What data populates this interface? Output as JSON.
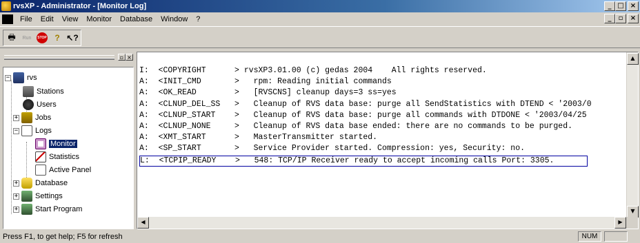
{
  "window": {
    "title": "rvsXP - Administrator - [Monitor Log]"
  },
  "menu": {
    "items": [
      "File",
      "Edit",
      "View",
      "Monitor",
      "Database",
      "Window",
      "?"
    ]
  },
  "toolbar": {
    "print_icon": "printer-icon",
    "run_label": "Run",
    "stop_label": "STOP",
    "help_icon": "question-icon",
    "context_help_icon": "arrow-question-icon"
  },
  "tree": {
    "root": "rvs",
    "items": [
      {
        "label": "Stations",
        "icon": "stations-icon"
      },
      {
        "label": "Users",
        "icon": "users-icon"
      },
      {
        "label": "Jobs",
        "icon": "jobs-icon"
      },
      {
        "label": "Logs",
        "icon": "logs-icon"
      },
      {
        "label": "Monitor",
        "icon": "monitor-icon"
      },
      {
        "label": "Statistics",
        "icon": "statistics-icon"
      },
      {
        "label": "Active Panel",
        "icon": "active-panel-icon"
      },
      {
        "label": "Database",
        "icon": "database-icon"
      },
      {
        "label": "Settings",
        "icon": "settings-icon"
      },
      {
        "label": "Start Program",
        "icon": "start-program-icon"
      }
    ]
  },
  "log": {
    "rows": [
      "I:  <COPYRIGHT      > rvsXP3.01.00 (c) gedas 2004    All rights reserved.",
      "A:  <INIT_CMD       >   rpm: Reading initial commands",
      "A:  <OK_READ        >   [RVSCNS] cleanup days=3 ss=yes",
      "A:  <CLNUP_DEL_SS   >   Cleanup of RVS data base: purge all SendStatistics with DTEND < '2003/0",
      "A:  <CLNUP_START    >   Cleanup of RVS data base: purge all commands with DTDONE < '2003/04/25",
      "A:  <CLNUP_NONE     >   Cleanup of RVS data base ended: there are no commands to be purged.",
      "A:  <XMT_START      >   MasterTransmitter started.",
      "A:  <SP_START       >   Service Provider started. Compression: yes, Security: no.",
      "L:  <TCPIP_READY    >   548: TCP/IP Receiver ready to accept incoming calls Port: 3305."
    ],
    "selected_row": 8
  },
  "status": {
    "help_text": "Press F1, to get help; F5 for refresh",
    "num": "NUM"
  }
}
